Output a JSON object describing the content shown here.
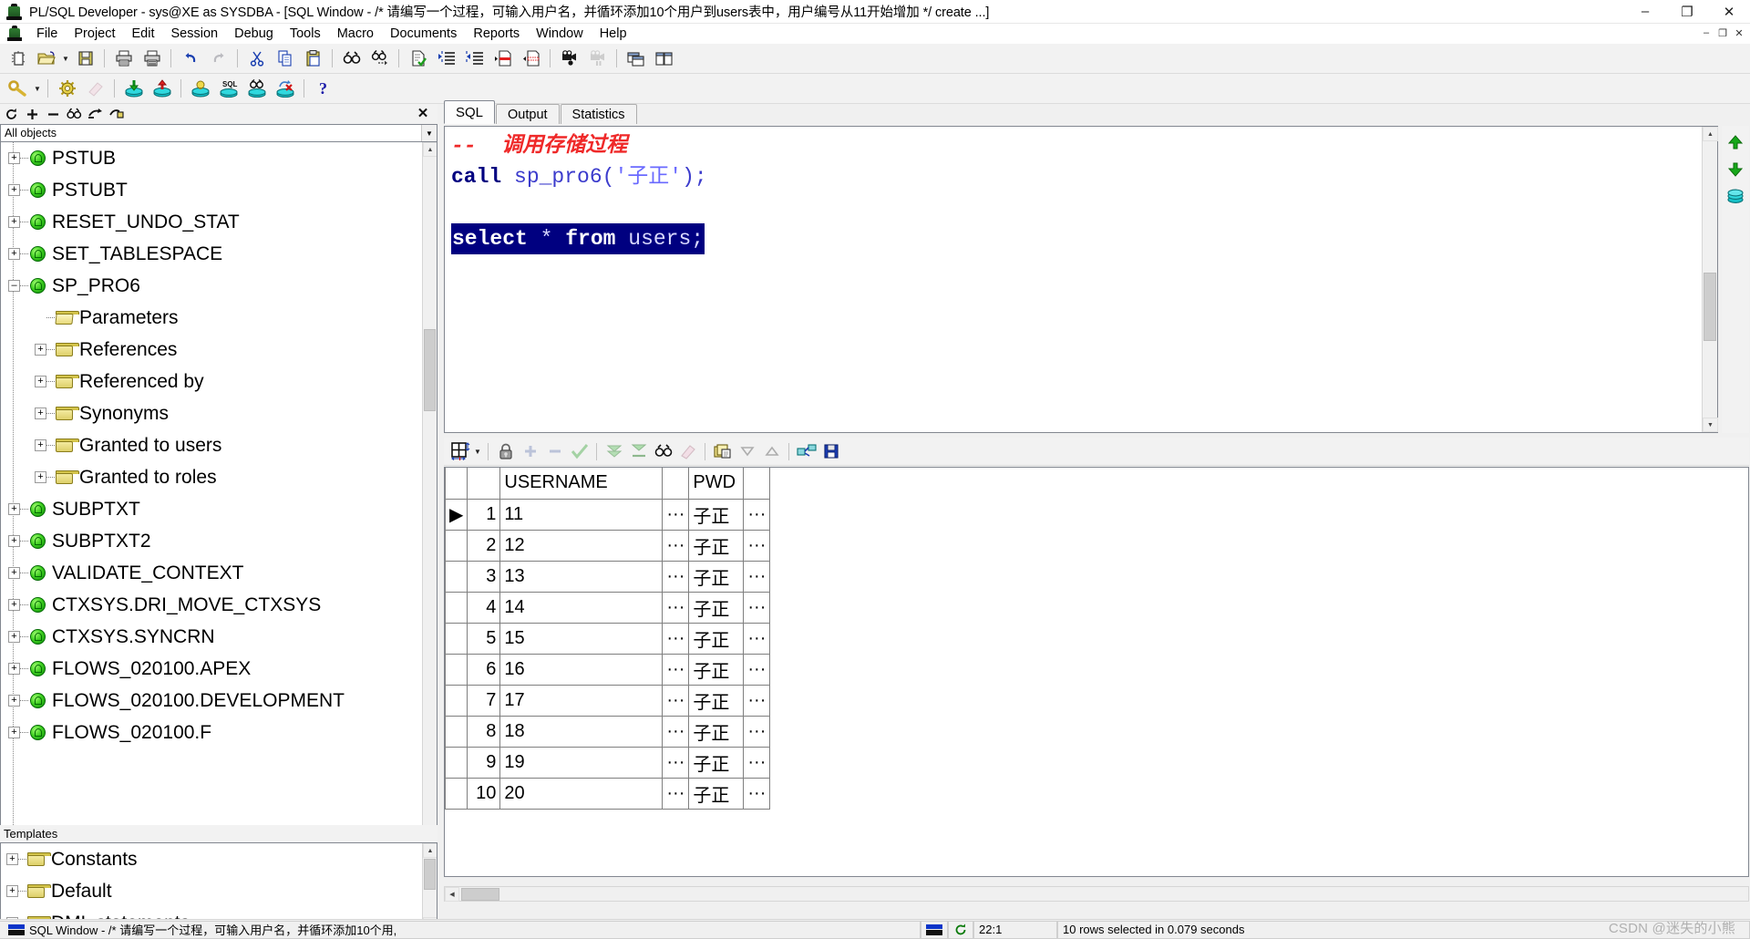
{
  "window": {
    "app_icon": "plsql-developer-icon",
    "title": "PL/SQL Developer - sys@XE as SYSDBA - [SQL Window - /* 请编写一个过程，可输入用户名，并循环添加10个用户到users表中，用户编号从11开始增加 */ create ...]",
    "minimize": "–",
    "maximize": "❐",
    "close": "✕",
    "mdi_restore": "–",
    "mdi_maximize": "❐",
    "mdi_close": "✕"
  },
  "menu": {
    "items": [
      {
        "label": "File",
        "name": "menu-file"
      },
      {
        "label": "Project",
        "name": "menu-project"
      },
      {
        "label": "Edit",
        "name": "menu-edit"
      },
      {
        "label": "Session",
        "name": "menu-session"
      },
      {
        "label": "Debug",
        "name": "menu-debug"
      },
      {
        "label": "Tools",
        "name": "menu-tools"
      },
      {
        "label": "Macro",
        "name": "menu-macro"
      },
      {
        "label": "Documents",
        "name": "menu-documents"
      },
      {
        "label": "Reports",
        "name": "menu-reports"
      },
      {
        "label": "Window",
        "name": "menu-window"
      },
      {
        "label": "Help",
        "name": "menu-help"
      }
    ]
  },
  "toolbar_main": {
    "buttons": [
      "new-window-icon",
      "open-folder-icon",
      "open-dropdown-arrow",
      "save-icon",
      "print-icon",
      "print-preview-icon",
      "undo-icon",
      "redo-icon",
      "cut-icon",
      "copy-icon",
      "paste-icon",
      "find-icon",
      "find-next-icon",
      "execute-icon",
      "indent-icon",
      "outdent-icon",
      "comment-icon",
      "uncomment-icon",
      "record-macro-icon",
      "play-macro-icon",
      "window-list-icon",
      "tile-windows-icon"
    ]
  },
  "toolbar_session": {
    "buttons": [
      "explain-plan-icon",
      "explain-dropdown-arrow",
      "settings-gear-icon",
      "eraser-icon",
      "import-table-icon",
      "export-table-icon",
      "session-info-icon",
      "sql-session-icon",
      "find-db-object-icon",
      "kill-session-icon",
      "help-question-icon"
    ]
  },
  "browser": {
    "toolbar_buttons": [
      "refresh-icon",
      "expand-all-icon",
      "collapse-all-icon",
      "find-object-icon",
      "goto-object-icon",
      "object-props-icon"
    ],
    "close_label": "✕",
    "filter": {
      "value": "All objects",
      "dropdown_arrow": "▼"
    },
    "tree": [
      {
        "label": "PSTUB",
        "icon": "procedure-icon",
        "indent": 0,
        "expander": "+"
      },
      {
        "label": "PSTUBT",
        "icon": "procedure-icon",
        "indent": 0,
        "expander": "+"
      },
      {
        "label": "RESET_UNDO_STAT",
        "icon": "procedure-icon",
        "indent": 0,
        "expander": "+"
      },
      {
        "label": "SET_TABLESPACE",
        "icon": "procedure-icon",
        "indent": 0,
        "expander": "+"
      },
      {
        "label": "SP_PRO6",
        "icon": "procedure-icon",
        "indent": 0,
        "expander": "–"
      },
      {
        "label": "Parameters",
        "icon": "folder-open-icon",
        "indent": 1,
        "expander": ""
      },
      {
        "label": "References",
        "icon": "folder-icon",
        "indent": 1,
        "expander": "+"
      },
      {
        "label": "Referenced by",
        "icon": "folder-icon",
        "indent": 1,
        "expander": "+"
      },
      {
        "label": "Synonyms",
        "icon": "folder-icon",
        "indent": 1,
        "expander": "+"
      },
      {
        "label": "Granted to users",
        "icon": "folder-icon",
        "indent": 1,
        "expander": "+"
      },
      {
        "label": "Granted to roles",
        "icon": "folder-icon",
        "indent": 1,
        "expander": "+"
      },
      {
        "label": "SUBPTXT",
        "icon": "procedure-icon",
        "indent": 0,
        "expander": "+"
      },
      {
        "label": "SUBPTXT2",
        "icon": "procedure-icon",
        "indent": 0,
        "expander": "+"
      },
      {
        "label": "VALIDATE_CONTEXT",
        "icon": "procedure-icon",
        "indent": 0,
        "expander": "+"
      },
      {
        "label": "CTXSYS.DRI_MOVE_CTXSYS",
        "icon": "procedure-icon",
        "indent": 0,
        "expander": "+"
      },
      {
        "label": "CTXSYS.SYNCRN",
        "icon": "procedure-icon",
        "indent": 0,
        "expander": "+"
      },
      {
        "label": "FLOWS_020100.APEX",
        "icon": "procedure-icon",
        "indent": 0,
        "expander": "+"
      },
      {
        "label": "FLOWS_020100.DEVELOPMENT",
        "icon": "procedure-icon",
        "indent": 0,
        "expander": "+"
      },
      {
        "label": "FLOWS_020100.F",
        "icon": "procedure-icon",
        "indent": 0,
        "expander": "+"
      }
    ]
  },
  "templates": {
    "header": "Templates",
    "items": [
      {
        "label": "Constants",
        "icon": "folder-icon",
        "expander": "+"
      },
      {
        "label": "Default",
        "icon": "folder-icon",
        "expander": "+"
      },
      {
        "label": "DML statements",
        "icon": "folder-icon",
        "expander": "+"
      }
    ]
  },
  "editor": {
    "tabs": [
      {
        "label": "SQL",
        "active": true,
        "name": "tab-sql"
      },
      {
        "label": "Output",
        "active": false,
        "name": "tab-output"
      },
      {
        "label": "Statistics",
        "active": false,
        "name": "tab-statistics"
      }
    ],
    "code_lines": [
      {
        "type": "comment",
        "text": "--  调用存储过程"
      },
      {
        "type": "call",
        "kw": "call",
        "fn": " sp_pro6(",
        "str": "'子正'",
        "tail": ");"
      },
      {
        "type": "blank",
        "text": ""
      },
      {
        "type": "selected",
        "kw": "select",
        "star": " * ",
        "from": "from",
        "tbl": " users;"
      }
    ],
    "side_buttons": [
      "scroll-up-icon",
      "scroll-down-icon",
      "session-list-icon"
    ]
  },
  "grid_toolbar": {
    "buttons": [
      "grid-layout-icon",
      "grid-layout-dropdown",
      "lock-icon",
      "add-row-icon",
      "remove-row-icon",
      "commit-check-icon",
      "fetch-next-page-icon",
      "fetch-last-page-icon",
      "find-in-grid-icon",
      "clear-filter-icon",
      "copy-grid-icon",
      "sort-desc-icon",
      "sort-asc-icon",
      "link-grid-icon",
      "save-grid-icon"
    ]
  },
  "result_grid": {
    "columns": [
      "",
      "",
      "USERNAME",
      "",
      "PWD",
      ""
    ],
    "headers": {
      "username": "USERNAME",
      "pwd": "PWD"
    },
    "rows": [
      {
        "marker": "▶",
        "num": "1",
        "username": "11",
        "dots1": "···",
        "pwd": "子正",
        "dots2": "···"
      },
      {
        "marker": "",
        "num": "2",
        "username": "12",
        "dots1": "···",
        "pwd": "子正",
        "dots2": "···"
      },
      {
        "marker": "",
        "num": "3",
        "username": "13",
        "dots1": "···",
        "pwd": "子正",
        "dots2": "···"
      },
      {
        "marker": "",
        "num": "4",
        "username": "14",
        "dots1": "···",
        "pwd": "子正",
        "dots2": "···"
      },
      {
        "marker": "",
        "num": "5",
        "username": "15",
        "dots1": "···",
        "pwd": "子正",
        "dots2": "···"
      },
      {
        "marker": "",
        "num": "6",
        "username": "16",
        "dots1": "···",
        "pwd": "子正",
        "dots2": "···"
      },
      {
        "marker": "",
        "num": "7",
        "username": "17",
        "dots1": "···",
        "pwd": "子正",
        "dots2": "···"
      },
      {
        "marker": "",
        "num": "8",
        "username": "18",
        "dots1": "···",
        "pwd": "子正",
        "dots2": "···"
      },
      {
        "marker": "",
        "num": "9",
        "username": "19",
        "dots1": "···",
        "pwd": "子正",
        "dots2": "···"
      },
      {
        "marker": "",
        "num": "10",
        "username": "20",
        "dots1": "···",
        "pwd": "子正",
        "dots2": "···"
      }
    ]
  },
  "statusbar": {
    "window_label": "SQL Window - /* 请编写一个过程，可输入用户名，并循环添加10个用,",
    "refresh_icon": "refresh-icon",
    "cursor_position": "22:1",
    "message": "10 rows selected in 0.079 seconds",
    "watermark": "CSDN @迷失的小熊"
  },
  "colors": {
    "comment_red": "#ef2929",
    "keyword_navy": "#000080",
    "identifier_blue": "#3b3bcc",
    "selection_bg": "#000080",
    "panel_bg": "#f2f2f2"
  }
}
